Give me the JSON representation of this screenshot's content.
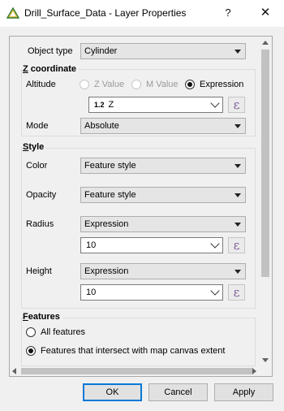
{
  "window": {
    "title": "Drill_Surface_Data - Layer Properties",
    "help_label": "?",
    "close_label": "✕",
    "icon": "qgis-triangle-icon"
  },
  "object_type": {
    "label": "Object type",
    "value": "Cylinder"
  },
  "z_coordinate": {
    "title": "Z coordinate",
    "title_accel": "Z",
    "title_rest": " coordinate",
    "altitude_label": "Altitude",
    "options": [
      {
        "label": "Z Value",
        "enabled": false,
        "checked": false
      },
      {
        "label": "M Value",
        "enabled": false,
        "checked": false
      },
      {
        "label": "Expression",
        "enabled": true,
        "checked": true
      }
    ],
    "field_type_prefix": "1.2",
    "field_value": "Z",
    "mode_label": "Mode",
    "mode_value": "Absolute"
  },
  "style": {
    "title": "Style",
    "title_accel": "S",
    "title_rest": "tyle",
    "color_label": "Color",
    "color_value": "Feature style",
    "opacity_label": "Opacity",
    "opacity_value": "Feature style",
    "radius_label": "Radius",
    "radius_mode": "Expression",
    "radius_value": "10",
    "height_label": "Height",
    "height_mode": "Expression",
    "height_value": "10"
  },
  "features": {
    "title": "Features",
    "title_accel": "F",
    "title_rest": "eatures",
    "options": [
      {
        "label": "All features",
        "checked": false
      },
      {
        "label": "Features that intersect with map canvas extent",
        "checked": true
      }
    ]
  },
  "expression_glyph": "ε",
  "buttons": {
    "ok": "OK",
    "cancel": "Cancel",
    "apply": "Apply"
  }
}
